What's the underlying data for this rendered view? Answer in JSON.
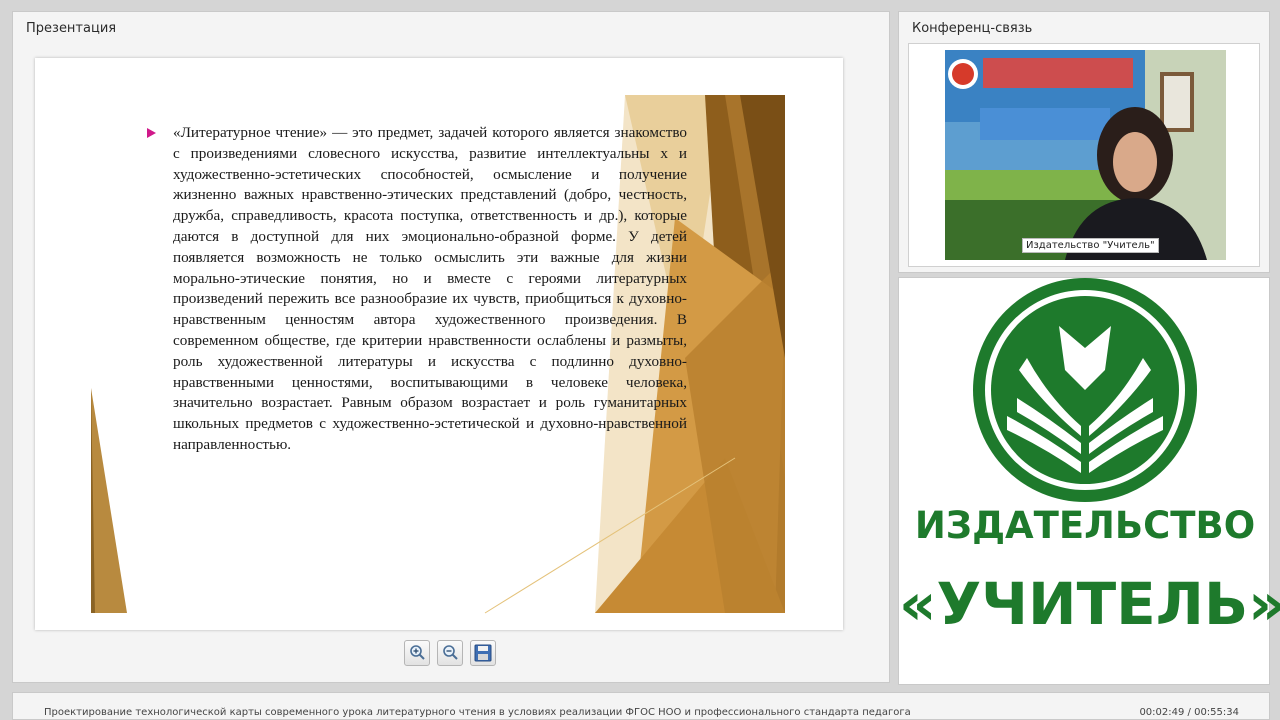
{
  "presentation": {
    "title": "Презентация",
    "slide_text": "«Литературное   чтение»   — это предмет,   задачей которого является                    знакомство                    с произведениями словесного искусства, развитие интеллектуальны х  и  художественно-эстетических  способностей,  осмысление  и  получение  жизненно  важных  нравственно-этических представлений (добро, честность, дружба, справедливость, красота поступка, ответственность и др.), которые даются в  доступной для них  эмоционально-образной  форме.  У  детей  появляется возможность   не только осмыслить   эти  важные для жизни  морально-этические  понятия,  но и вместе с героями литературных произведений  пережить все разнообразие их  чувств, приобщиться         к         духовно-нравственным ценностям  автора  художественного произведения. В современном обществе, где критерии  нравственности  ослаблены и размыты, роль художественной литературы  и искусства с  подлинно духовно-нравственными ценностями, воспитывающими  в   человеке человека, значительно  возрастает. Равным образом возрастает  и роль гуманитарных школьных предметов с   художественно-эстетической и духовно-нравственной  направленностью.",
    "toolbar": {
      "zoom_in_icon": "zoom-in-icon",
      "zoom_out_icon": "zoom-out-icon",
      "save_icon": "save-icon"
    }
  },
  "conference": {
    "title": "Конференц-связь",
    "participant_label": "Издательство \"Учитель\""
  },
  "logo": {
    "word1": "ИЗДАТЕЛЬСТВО",
    "word2": "«УЧИТЕЛЬ»",
    "color": "#1e7a2c"
  },
  "footer": {
    "course_title": "Проектирование технологической карты современного урока литературного чтения в условиях реализации ФГОС НОО и профессионального стандарта педагога",
    "time": "00:02:49 / 00:55:34"
  }
}
